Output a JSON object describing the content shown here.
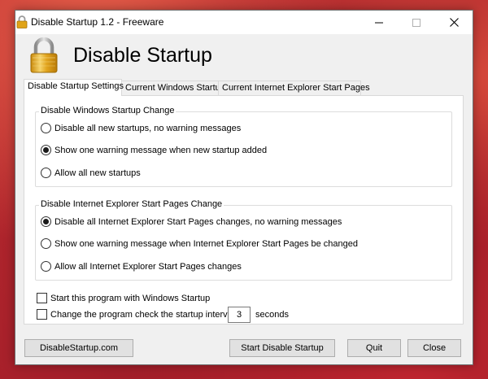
{
  "window": {
    "title": "Disable Startup 1.2 - Freeware",
    "controls": {
      "minimize": "minimize-icon",
      "maximize": "maximize-icon",
      "close": "close-icon"
    }
  },
  "header": {
    "title": "Disable Startup",
    "icon": "padlock-icon"
  },
  "tabs": [
    {
      "label": "Disable Startup Settings",
      "active": true
    },
    {
      "label": "Current Windows Startup",
      "active": false
    },
    {
      "label": "Current Internet Explorer Start Pages",
      "active": false
    }
  ],
  "windows_group": {
    "legend": "Disable Windows Startup Change",
    "options": [
      {
        "label": "Disable all new startups, no warning messages",
        "checked": false
      },
      {
        "label": "Show one warning message when new startup added",
        "checked": true
      },
      {
        "label": "Allow all new startups",
        "checked": false
      }
    ]
  },
  "ie_group": {
    "legend": "Disable Internet Explorer Start Pages Change",
    "options": [
      {
        "label": "Disable all Internet Explorer Start Pages changes, no warning messages",
        "checked": true
      },
      {
        "label": "Show one warning message when Internet Explorer Start Pages be changed",
        "checked": false
      },
      {
        "label": "Allow all Internet Explorer Start Pages changes",
        "checked": false
      }
    ]
  },
  "checks": {
    "start_with_windows": {
      "label": "Start this program with Windows Startup",
      "checked": false
    },
    "interval": {
      "label": "Change the program check the startup interval in",
      "value": "3",
      "unit": "seconds",
      "checked": false
    }
  },
  "buttons": {
    "website": "DisableStartup.com",
    "start": "Start Disable Startup",
    "quit": "Quit",
    "close": "Close"
  }
}
